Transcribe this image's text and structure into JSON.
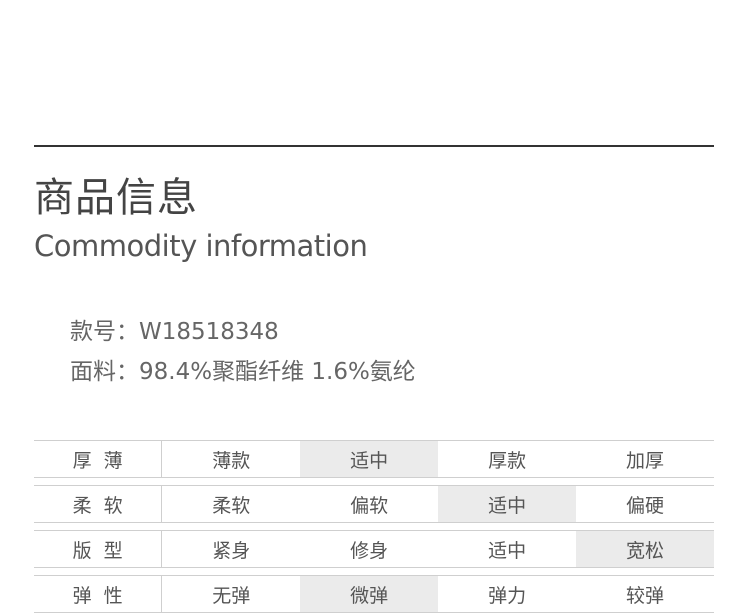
{
  "header": {
    "title_cn": "商品信息",
    "title_en": "Commodity information"
  },
  "specs": {
    "code_text": "款号：W18518348",
    "fabric_text": "面料：98.4%聚酯纤维 1.6%氨纶"
  },
  "attributes": [
    {
      "label": "厚薄",
      "options": [
        "薄款",
        "适中",
        "厚款",
        "加厚"
      ],
      "selected_index": 1
    },
    {
      "label": "柔软",
      "options": [
        "柔软",
        "偏软",
        "适中",
        "偏硬"
      ],
      "selected_index": 2
    },
    {
      "label": "版型",
      "options": [
        "紧身",
        "修身",
        "适中",
        "宽松"
      ],
      "selected_index": 3
    },
    {
      "label": "弹性",
      "options": [
        "无弹",
        "微弹",
        "弹力",
        "较弹"
      ],
      "selected_index": 1
    }
  ],
  "colors": {
    "rule": "#333333",
    "text": "#555555",
    "selected_bg": "#ebebeb",
    "border": "#cfcfcf"
  }
}
